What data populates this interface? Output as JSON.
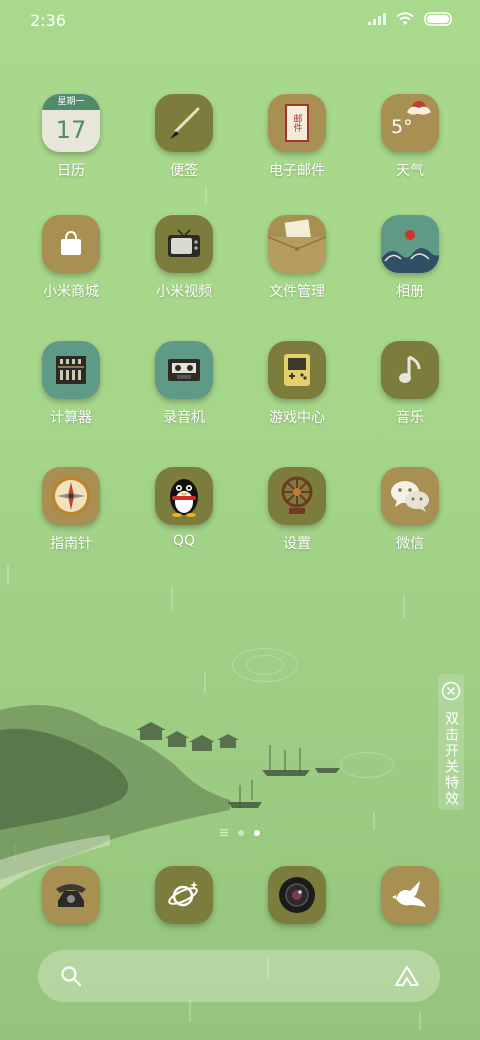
{
  "status": {
    "time": "2:36"
  },
  "apps": [
    {
      "label": "日历",
      "icon": "calendar-icon",
      "weekday": "星期一",
      "day": "17"
    },
    {
      "label": "便签",
      "icon": "brush-notes-icon"
    },
    {
      "label": "电子邮件",
      "icon": "mail-letter-icon",
      "stamp": "邮件"
    },
    {
      "label": "天气",
      "icon": "weather-cloud-icon",
      "temp": "5°"
    },
    {
      "label": "小米商城",
      "icon": "shopping-bag-icon"
    },
    {
      "label": "小米视频",
      "icon": "tv-icon"
    },
    {
      "label": "文件管理",
      "icon": "folder-icon"
    },
    {
      "label": "相册",
      "icon": "wave-sun-icon"
    },
    {
      "label": "计算器",
      "icon": "abacus-icon"
    },
    {
      "label": "录音机",
      "icon": "cassette-icon"
    },
    {
      "label": "游戏中心",
      "icon": "gameboy-icon"
    },
    {
      "label": "音乐",
      "icon": "music-note-icon"
    },
    {
      "label": "指南针",
      "icon": "compass-icon"
    },
    {
      "label": "QQ",
      "icon": "penguin-icon"
    },
    {
      "label": "设置",
      "icon": "dharma-wheel-icon"
    },
    {
      "label": "微信",
      "icon": "chat-bubbles-icon"
    }
  ],
  "dock": [
    {
      "icon": "phone-icon"
    },
    {
      "icon": "planet-browser-icon"
    },
    {
      "icon": "camera-icon"
    },
    {
      "icon": "dove-icon"
    }
  ],
  "side_toggle": {
    "text": "双击开关特效"
  },
  "page_indicator": {
    "pages": 3,
    "active": 2
  }
}
